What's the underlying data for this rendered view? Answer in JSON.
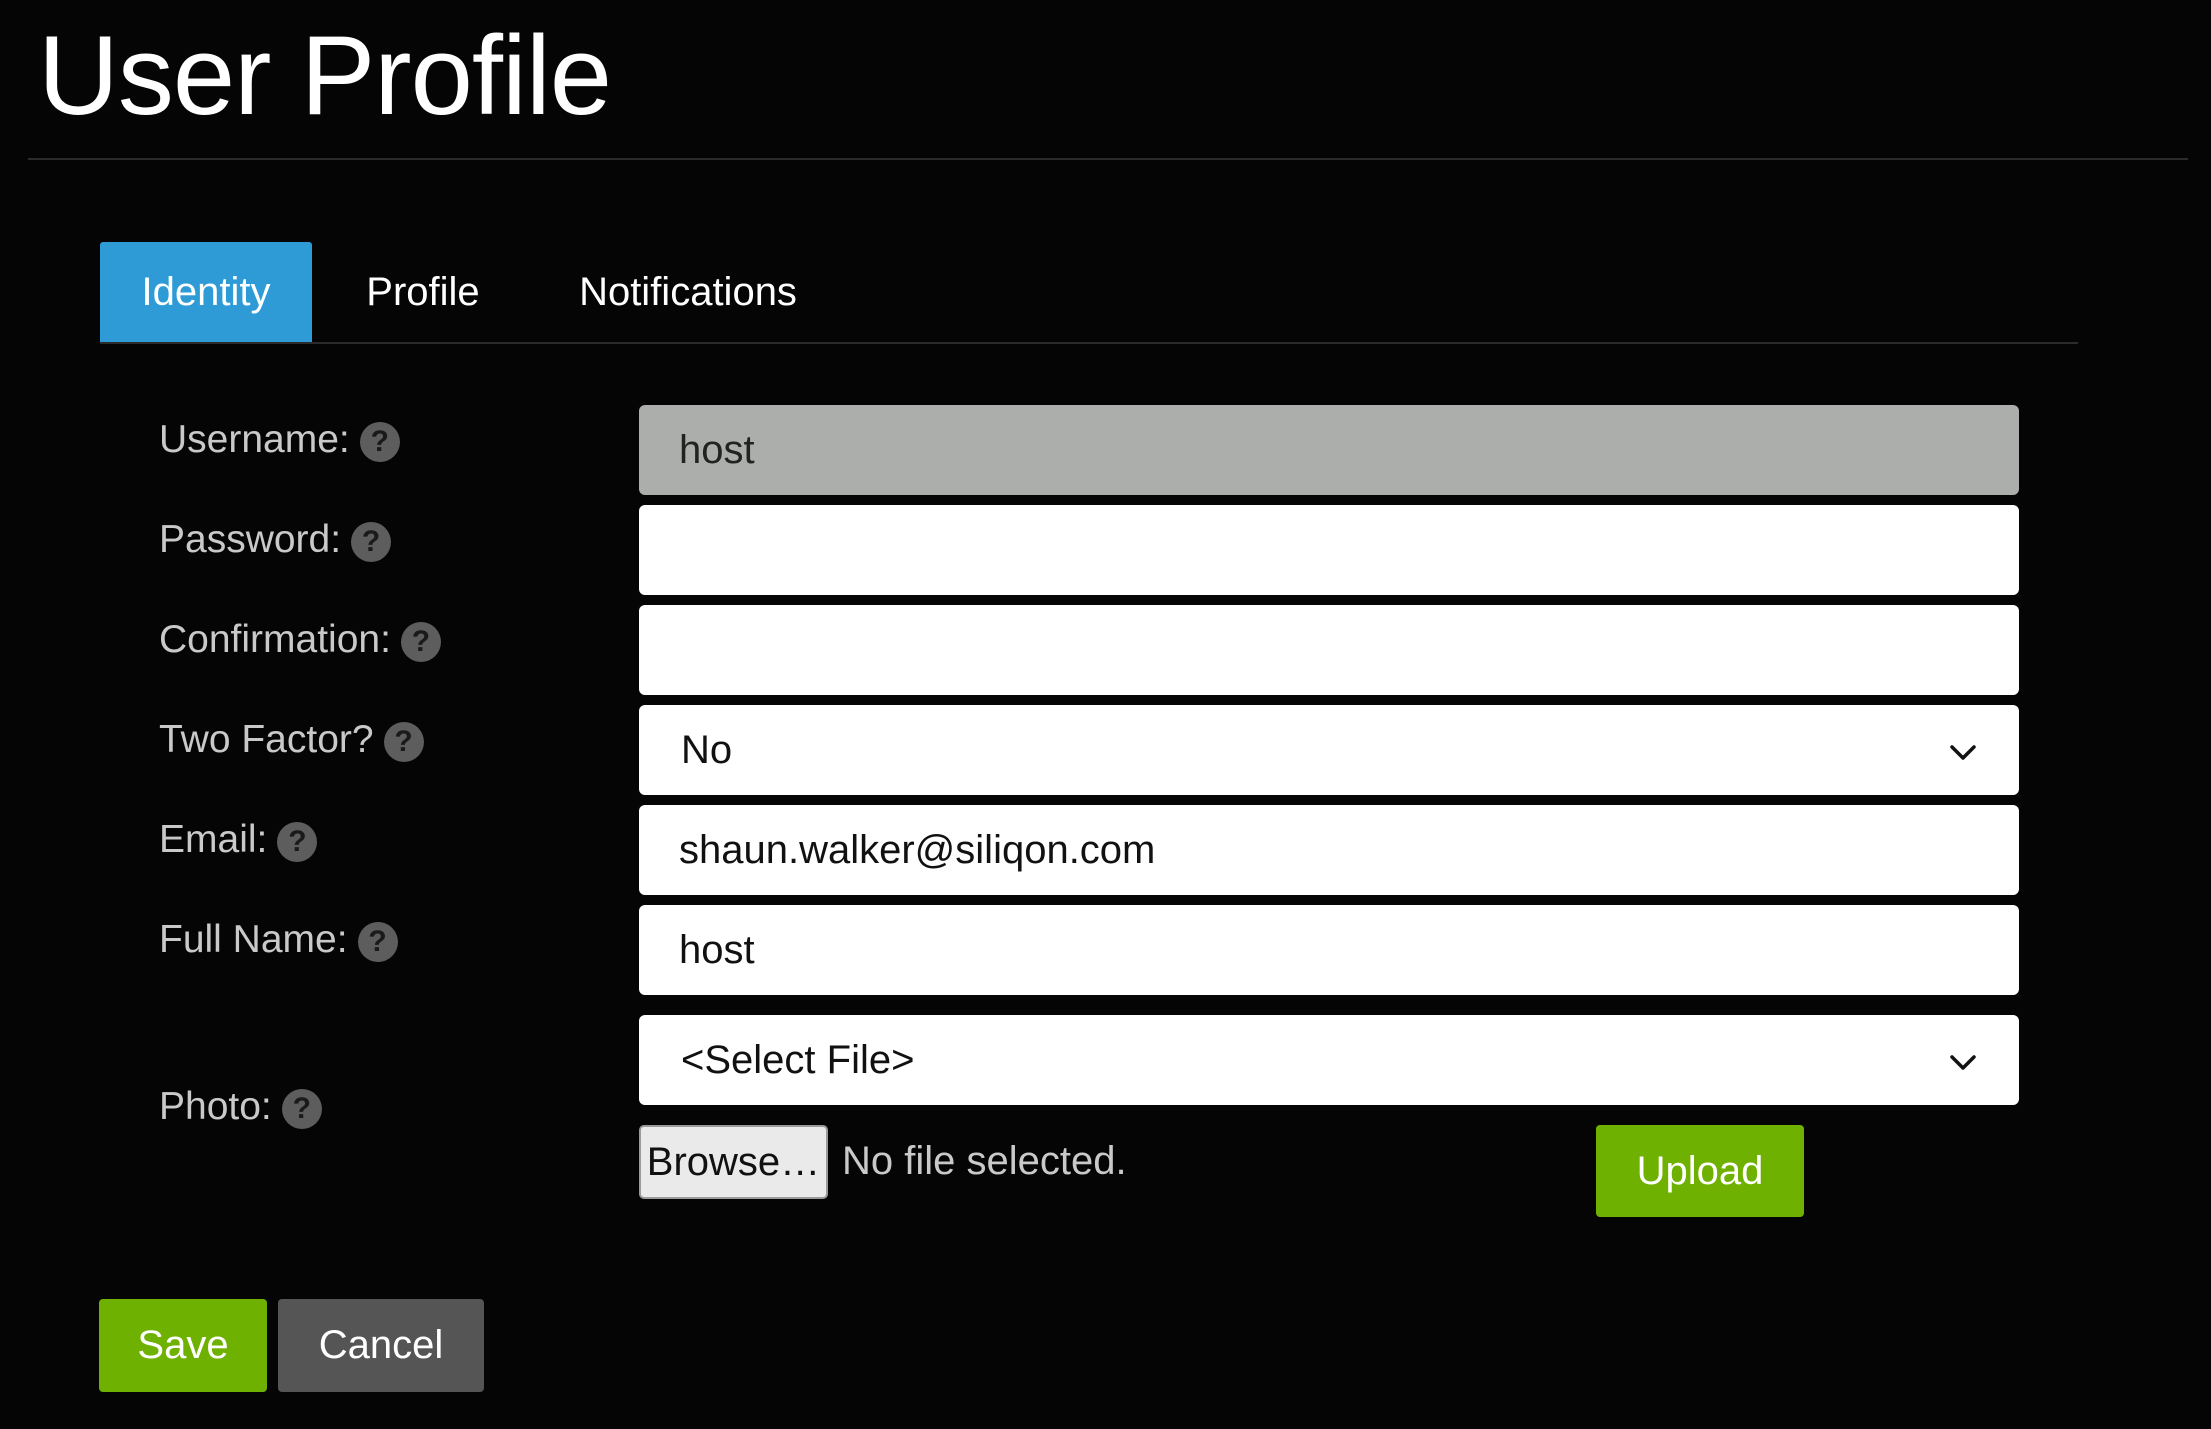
{
  "page": {
    "title": "User Profile"
  },
  "tabs": [
    {
      "label": "Identity",
      "active": true
    },
    {
      "label": "Profile",
      "active": false
    },
    {
      "label": "Notifications",
      "active": false
    }
  ],
  "form": {
    "username": {
      "label": "Username:",
      "value": "host",
      "readonly": true
    },
    "password": {
      "label": "Password:",
      "value": ""
    },
    "confirmation": {
      "label": "Confirmation:",
      "value": ""
    },
    "two_factor": {
      "label": "Two Factor?",
      "selected": "No"
    },
    "email": {
      "label": "Email:",
      "value": "shaun.walker@siliqon.com"
    },
    "full_name": {
      "label": "Full Name:",
      "value": "host"
    },
    "photo": {
      "label": "Photo:",
      "selected": "<Select File>",
      "browse_label": "Browse…",
      "file_status": "No file selected.",
      "upload_label": "Upload"
    }
  },
  "help_icon": {
    "symbol": "?",
    "icon": "help-icon"
  },
  "actions": {
    "save_label": "Save",
    "cancel_label": "Cancel"
  },
  "colors": {
    "background": "#050505",
    "active_tab": "#2e9bd6",
    "primary_button": "#6eb100",
    "secondary_button": "#555555",
    "readonly_field": "#acaeac"
  }
}
